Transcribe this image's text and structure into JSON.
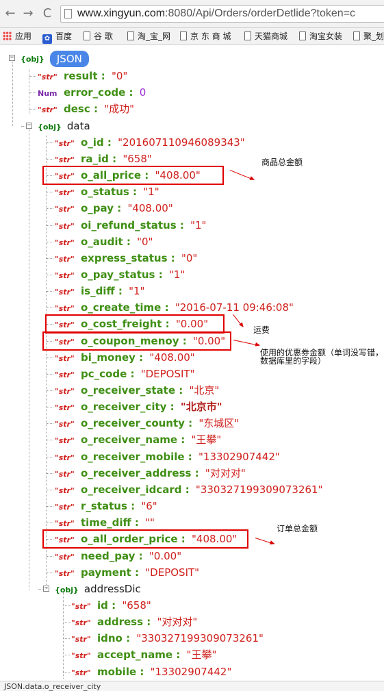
{
  "browser": {
    "url_host": "www.xingyun.com",
    "url_rest": ":8080/Api/Orders/orderDetlide?token=c",
    "bookmarks": [
      {
        "label": "应用",
        "icon": "apps-grid-icon"
      },
      {
        "label": "百度",
        "icon": "baidu-paw-icon"
      },
      {
        "label": "谷 歌",
        "icon": "page-icon"
      },
      {
        "label": "淘_宝_网",
        "icon": "page-icon"
      },
      {
        "label": "京 东 商 城",
        "icon": "page-icon"
      },
      {
        "label": "天猫商城",
        "icon": "page-icon"
      },
      {
        "label": "淘宝女装",
        "icon": "page-icon"
      },
      {
        "label": "聚_划",
        "icon": "page-icon"
      }
    ]
  },
  "tree": {
    "root_tag": "{obj}",
    "root_badge": "JSON",
    "top": [
      {
        "tag": "\"str\"",
        "key": "result",
        "value": "\"0\""
      },
      {
        "tag": "Num",
        "key": "error_code",
        "value": "0"
      },
      {
        "tag": "\"str\"",
        "key": "desc",
        "value": "\"成功\""
      }
    ],
    "data_tag": "{obj}",
    "data_name": "data",
    "data_items": [
      {
        "tag": "\"str\"",
        "key": "o_id",
        "value": "\"201607110946089343\""
      },
      {
        "tag": "\"str\"",
        "key": "ra_id",
        "value": "\"658\""
      },
      {
        "tag": "\"str\"",
        "key": "o_all_price",
        "value": "\"408.00\""
      },
      {
        "tag": "\"str\"",
        "key": "o_status",
        "value": "\"1\""
      },
      {
        "tag": "\"str\"",
        "key": "o_pay",
        "value": "\"408.00\""
      },
      {
        "tag": "\"str\"",
        "key": "oi_refund_status",
        "value": "\"1\""
      },
      {
        "tag": "\"str\"",
        "key": "o_audit",
        "value": "\"0\""
      },
      {
        "tag": "\"str\"",
        "key": "express_status",
        "value": "\"0\""
      },
      {
        "tag": "\"str\"",
        "key": "o_pay_status",
        "value": "\"1\""
      },
      {
        "tag": "\"str\"",
        "key": "is_diff",
        "value": "\"1\""
      },
      {
        "tag": "\"str\"",
        "key": "o_create_time",
        "value": "\"2016-07-11 09:46:08\""
      },
      {
        "tag": "\"str\"",
        "key": "o_cost_freight",
        "value": "\"0.00\""
      },
      {
        "tag": "\"str\"",
        "key": "o_coupon_menoy",
        "value": "\"0.00\""
      },
      {
        "tag": "\"str\"",
        "key": "bi_money",
        "value": "\"408.00\""
      },
      {
        "tag": "\"str\"",
        "key": "pc_code",
        "value": "\"DEPOSIT\""
      },
      {
        "tag": "\"str\"",
        "key": "o_receiver_state",
        "value": "\"北京\""
      },
      {
        "tag": "\"str\"",
        "key": "o_receiver_city",
        "value": "\"北京市\""
      },
      {
        "tag": "\"str\"",
        "key": "o_receiver_county",
        "value": "\"东城区\""
      },
      {
        "tag": "\"str\"",
        "key": "o_receiver_name",
        "value": "\"王攀\""
      },
      {
        "tag": "\"str\"",
        "key": "o_receiver_mobile",
        "value": "\"13302907442\""
      },
      {
        "tag": "\"str\"",
        "key": "o_receiver_address",
        "value": "\"对对对\""
      },
      {
        "tag": "\"str\"",
        "key": "o_receiver_idcard",
        "value": "\"330327199309073261\""
      },
      {
        "tag": "\"str\"",
        "key": "r_status",
        "value": "\"6\""
      },
      {
        "tag": "\"str\"",
        "key": "time_diff",
        "value": "\"\""
      },
      {
        "tag": "\"str\"",
        "key": "o_all_order_price",
        "value": "\"408.00\""
      },
      {
        "tag": "\"str\"",
        "key": "need_pay",
        "value": "\"0.00\""
      },
      {
        "tag": "\"str\"",
        "key": "payment",
        "value": "\"DEPOSIT\""
      }
    ],
    "address_tag": "{obj}",
    "address_name": "addressDic",
    "address_items": [
      {
        "tag": "\"str\"",
        "key": "id",
        "value": "\"658\""
      },
      {
        "tag": "\"str\"",
        "key": "address",
        "value": "\"对对对\""
      },
      {
        "tag": "\"str\"",
        "key": "idno",
        "value": "\"330327199309073261\""
      },
      {
        "tag": "\"str\"",
        "key": "accept_name",
        "value": "\"王攀\""
      },
      {
        "tag": "\"str\"",
        "key": "mobile",
        "value": "\"13302907442\""
      }
    ]
  },
  "annotations": {
    "total_price": "商品总金额",
    "freight": "运费",
    "coupon_line1": "使用的优惠券金额（单词没写错，",
    "coupon_line2": "数据库里的字段）",
    "order_total": "订单总金额"
  },
  "status_bar": "JSON.data.o_receiver_city",
  "colors": {
    "key": "#3f8f14",
    "string_value": "#d0201c",
    "number_value": "#9a2fd0",
    "annotation_box": "#e00000",
    "badge": "#4a86e8"
  }
}
